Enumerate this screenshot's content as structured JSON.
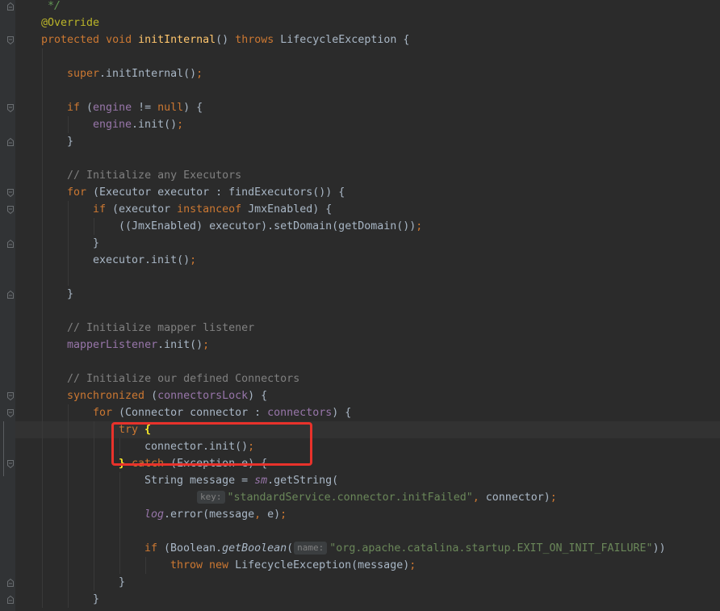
{
  "theme": {
    "background": "#2B2B2B",
    "gutter": "#313335",
    "caret_line": "#323232",
    "text": "#A9B7C6",
    "keyword": "#CC7832",
    "field": "#9876AA",
    "string": "#6A8759",
    "comment": "#808080",
    "doc_comment": "#629755",
    "annotation": "#BBB529",
    "method_declaration": "#FFC66D",
    "matched_brace": "#FFEF28",
    "hint_background": "#3B3E40",
    "hint_text": "#808080",
    "indent_guide": "#393939",
    "fold_marker": "#6B6F72",
    "annotation_box": "#E8322B"
  },
  "editor": {
    "lines": [
      [
        "*/"
      ],
      [
        "@Override"
      ],
      [
        "protected ",
        "void ",
        "initInternal",
        "() ",
        "throws ",
        "LifecycleException {"
      ],
      [],
      [
        "super",
        ".initInternal()",
        ";"
      ],
      [],
      [
        "if ",
        "(",
        "engine",
        " != ",
        "null",
        ") {"
      ],
      [
        "engine",
        ".init()",
        ";"
      ],
      [
        "}"
      ],
      [],
      [
        "// Initialize any Executors"
      ],
      [
        "for ",
        "(Executor executor : findExecutors()) {"
      ],
      [
        "if ",
        "(executor ",
        "instanceof ",
        "JmxEnabled) {"
      ],
      [
        "((JmxEnabled) executor).setDomain(getDomain())",
        ";"
      ],
      [
        "}"
      ],
      [
        "executor.init()",
        ";"
      ],
      [],
      [
        "}"
      ],
      [],
      [
        "// Initialize mapper listener"
      ],
      [
        "mapperListener",
        ".init()",
        ";"
      ],
      [],
      [
        "// Initialize our defined Connectors"
      ],
      [
        "synchronized ",
        "(",
        "connectorsLock",
        ") {"
      ],
      [
        "for ",
        "(Connector connector : ",
        "connectors",
        ") {"
      ],
      [
        "try ",
        "{"
      ],
      [
        "connector.init()",
        ";"
      ],
      [
        "}",
        " catch ",
        "(Exception e) {"
      ],
      [
        "String message = ",
        "sm",
        ".getString("
      ],
      [
        "key:",
        "\"standardService.connector.initFailed\"",
        ", ",
        "connector)",
        ";"
      ],
      [
        "log",
        ".error(message",
        ", ",
        "e)",
        ";"
      ],
      [],
      [
        "if ",
        "(Boolean.",
        "getBoolean",
        "(",
        "name:",
        "\"org.apache.catalina.startup.EXIT_ON_INIT_FAILURE\"",
        "))"
      ],
      [
        "throw new ",
        "LifecycleException(message)",
        ";"
      ],
      [
        "}"
      ],
      [
        "}"
      ]
    ]
  }
}
